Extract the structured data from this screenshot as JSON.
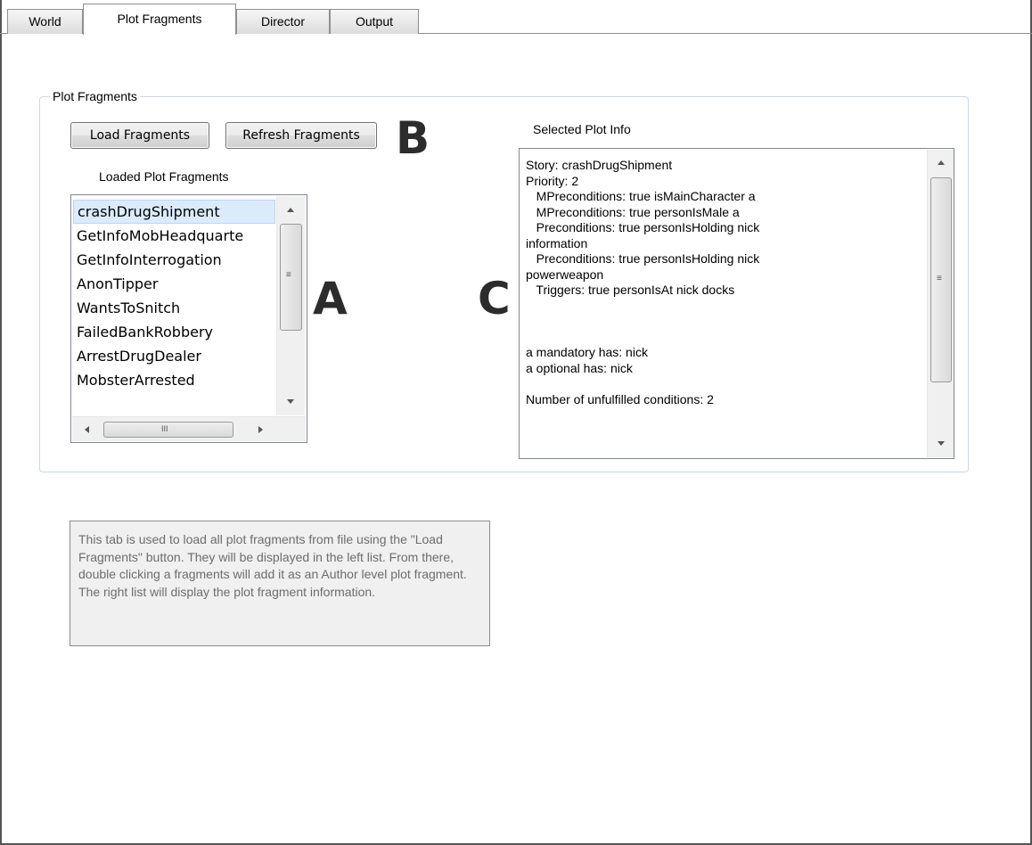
{
  "tabs": [
    {
      "label": "World"
    },
    {
      "label": "Plot Fragments"
    },
    {
      "label": "Director"
    },
    {
      "label": "Output"
    }
  ],
  "group": {
    "title": "Plot Fragments",
    "load_button": "Load Fragments",
    "refresh_button": "Refresh Fragments",
    "loaded_label": "Loaded Plot Fragments",
    "selected_label": "Selected Plot Info"
  },
  "annotations": {
    "a": "A",
    "b": "B",
    "c": "C"
  },
  "fragments": [
    "crashDrugShipment",
    "GetInfoMobHeadquarte",
    "GetInfoInterrogation",
    "AnonTipper",
    "WantsToSnitch",
    "FailedBankRobbery",
    "ArrestDrugDealer",
    "MobsterArrested"
  ],
  "selected_fragment_index": 0,
  "info_lines": [
    "Story: crashDrugShipment",
    "Priority: 2",
    "   MPreconditions: true isMainCharacter a",
    "   MPreconditions: true personIsMale a",
    "   Preconditions: true personIsHolding nick",
    "information",
    "   Preconditions: true personIsHolding nick",
    "powerweapon",
    "   Triggers: true personIsAt nick docks",
    "",
    "",
    "",
    "a mandatory has: nick",
    "a optional has: nick",
    "",
    "Number of unfulfilled conditions: 2"
  ],
  "scroll_glyphs": {
    "grip": "≡",
    "grip_h": "III"
  },
  "help_text": "This tab is used to load all plot fragments from file using the \"Load Fragments\" button. They will be displayed in the left list. From there, double clicking a fragments will add it as an Author level plot fragment. The right list will display the plot fragment information."
}
